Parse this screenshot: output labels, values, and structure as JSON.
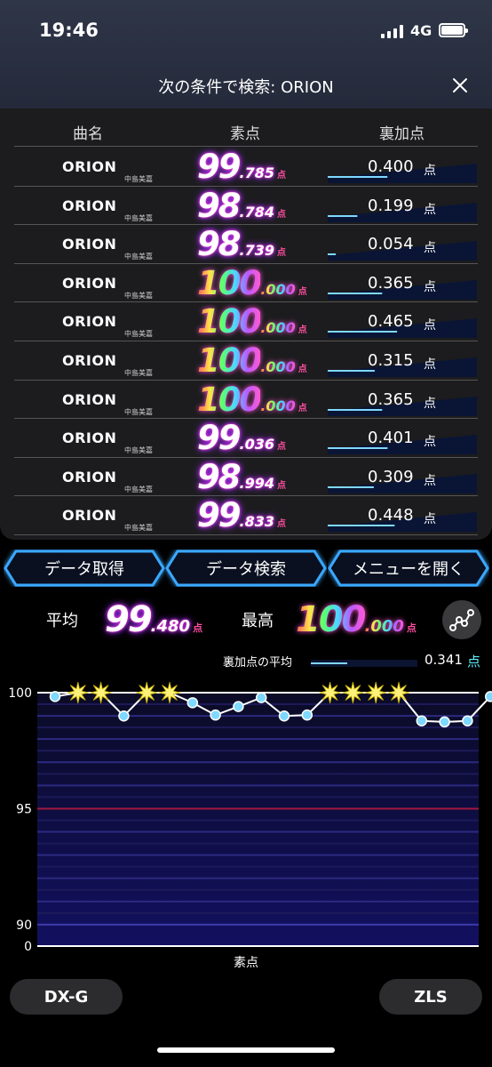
{
  "status": {
    "time": "19:46",
    "network": "4G"
  },
  "header": {
    "title": "次の条件で検索: ORION"
  },
  "table": {
    "columns": [
      "曲名",
      "素点",
      "裏加点"
    ],
    "rows": [
      {
        "song": "ORION",
        "artist": "中島美嘉",
        "score_int": "99",
        "score_dec": ".785",
        "score_unit": "点",
        "bonus": "0.400",
        "bonus_unit": "点",
        "rainbow": false
      },
      {
        "song": "ORION",
        "artist": "中島美嘉",
        "score_int": "98",
        "score_dec": ".784",
        "score_unit": "点",
        "bonus": "0.199",
        "bonus_unit": "点",
        "rainbow": false
      },
      {
        "song": "ORION",
        "artist": "中島美嘉",
        "score_int": "98",
        "score_dec": ".739",
        "score_unit": "点",
        "bonus": "0.054",
        "bonus_unit": "点",
        "rainbow": false
      },
      {
        "song": "ORION",
        "artist": "中島美嘉",
        "score_int": "100",
        "score_dec": ".000",
        "score_unit": "点",
        "bonus": "0.365",
        "bonus_unit": "点",
        "rainbow": true
      },
      {
        "song": "ORION",
        "artist": "中島美嘉",
        "score_int": "100",
        "score_dec": ".000",
        "score_unit": "点",
        "bonus": "0.465",
        "bonus_unit": "点",
        "rainbow": true
      },
      {
        "song": "ORION",
        "artist": "中島美嘉",
        "score_int": "100",
        "score_dec": ".000",
        "score_unit": "点",
        "bonus": "0.315",
        "bonus_unit": "点",
        "rainbow": true
      },
      {
        "song": "ORION",
        "artist": "中島美嘉",
        "score_int": "100",
        "score_dec": ".000",
        "score_unit": "点",
        "bonus": "0.365",
        "bonus_unit": "点",
        "rainbow": true
      },
      {
        "song": "ORION",
        "artist": "中島美嘉",
        "score_int": "99",
        "score_dec": ".036",
        "score_unit": "点",
        "bonus": "0.401",
        "bonus_unit": "点",
        "rainbow": false
      },
      {
        "song": "ORION",
        "artist": "中島美嘉",
        "score_int": "98",
        "score_dec": ".994",
        "score_unit": "点",
        "bonus": "0.309",
        "bonus_unit": "点",
        "rainbow": false
      },
      {
        "song": "ORION",
        "artist": "中島美嘉",
        "score_int": "99",
        "score_dec": ".833",
        "score_unit": "点",
        "bonus": "0.448",
        "bonus_unit": "点",
        "rainbow": false
      }
    ]
  },
  "nav": {
    "get_data": "データ取得",
    "search_data": "データ検索",
    "open_menu": "メニューを開く"
  },
  "stats": {
    "average_label": "平均",
    "average_int": "99",
    "average_dec": ".480",
    "max_label": "最高",
    "max_int": "100",
    "max_dec": ".000",
    "unit": "点",
    "avg_bonus_label": "裏加点の平均",
    "avg_bonus_value": "0.341",
    "avg_bonus_unit": "点"
  },
  "chart_data": {
    "type": "line",
    "xlabel": "素点",
    "ylabel": "",
    "yticks": [
      "100",
      "95",
      "90",
      "0"
    ],
    "ylim": [
      89,
      100.5
    ],
    "x": [
      1,
      2,
      3,
      4,
      5,
      6,
      7,
      8,
      9,
      10,
      11,
      12,
      13,
      14,
      15,
      16,
      17,
      18,
      19,
      20
    ],
    "values": [
      99.833,
      100.0,
      100.0,
      98.994,
      100.0,
      100.0,
      99.565,
      99.036,
      99.401,
      99.785,
      98.994,
      99.036,
      100.0,
      100.0,
      100.0,
      100.0,
      98.784,
      98.739,
      98.784,
      99.833
    ],
    "star_value": 100.0,
    "colors": {
      "line": "#ffffff",
      "point": "#7fd8ff",
      "star": "#fff27a",
      "ref100": "#ffffff",
      "ref95": "#a01840"
    }
  },
  "footer": {
    "left_pill": "DX-G",
    "right_pill": "ZLS"
  },
  "colors": {
    "accent_blue": "#3aa8ff",
    "pink": "#ff4fa0",
    "cyan": "#5ef0ff"
  }
}
